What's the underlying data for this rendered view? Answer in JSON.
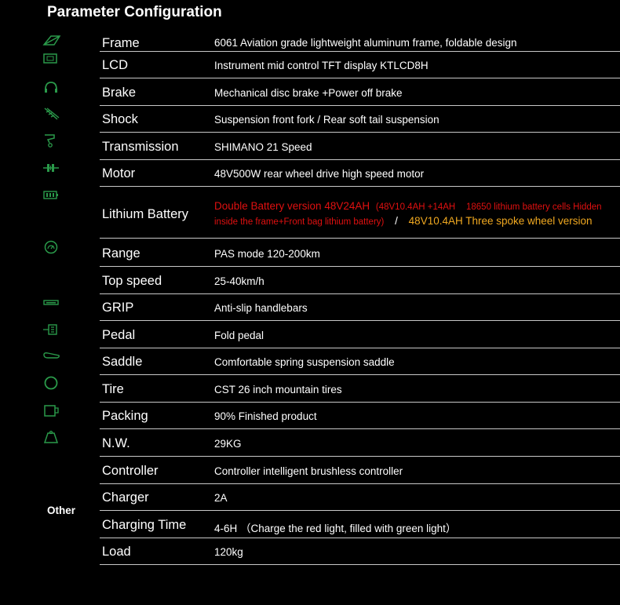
{
  "title": "Parameter Configuration",
  "rows": [
    {
      "label": "Frame",
      "value": "6061 Aviation grade lightweight aluminum frame, foldable design",
      "icon": "frame-icon"
    },
    {
      "label": "LCD",
      "value": "Instrument mid control TFT display KTLCD8H",
      "icon": "lcd-icon"
    },
    {
      "label": "Brake",
      "value": "Mechanical disc brake +Power off brake",
      "icon": "brake-icon"
    },
    {
      "label": "Shock",
      "value": "Suspension front fork / Rear soft tail suspension",
      "icon": "shock-icon"
    },
    {
      "label": "Transmission",
      "value": "SHIMANO 21 Speed",
      "icon": "transmission-icon"
    },
    {
      "label": "Motor",
      "value": "48V500W rear wheel drive high speed motor",
      "icon": "motor-icon"
    },
    {
      "label": "Lithium Battery",
      "icon": "battery-icon",
      "value_parts": {
        "red_main": "Double Battery version 48V24AH",
        "red_small_1": "(48V10.4AH  +14AH",
        "red_small_2": "18650 lithium battery cells Hidden",
        "red_small_3": "inside the frame+Front bag lithium battery)",
        "separator": "/",
        "orange": "48V10.4AH Three spoke wheel version"
      }
    },
    {
      "label": "Range",
      "value": "PAS mode 120-200km",
      "icon": "speedometer-icon"
    },
    {
      "label": "Top speed",
      "value": "25-40km/h"
    },
    {
      "label": "GRIP",
      "value": "Anti-slip handlebars",
      "icon": "grip-icon"
    },
    {
      "label": "Pedal",
      "value": "Fold pedal",
      "icon": "pedal-icon"
    },
    {
      "label": "Saddle",
      "value": "Comfortable spring suspension saddle",
      "icon": "saddle-icon"
    },
    {
      "label": "Tire",
      "value": "CST 26 inch mountain tires",
      "icon": "tire-icon"
    },
    {
      "label": "Packing",
      "value": "90% Finished product",
      "icon": "packing-icon"
    },
    {
      "label": "N.W.",
      "value": "29KG",
      "icon": "weight-icon"
    },
    {
      "label": "Controller",
      "value": "Controller intelligent brushless controller"
    },
    {
      "label": "Charger",
      "value": "2A"
    },
    {
      "label": "Charging Time",
      "value": "4-6H （Charge the red light, filled with green light）"
    },
    {
      "label": "Load",
      "value": "120kg"
    }
  ],
  "other_label": "Other",
  "colors": {
    "icon": "#2a9a4a",
    "red": "#e01010",
    "orange": "#f0a820",
    "divider": "#c8c8c8"
  }
}
